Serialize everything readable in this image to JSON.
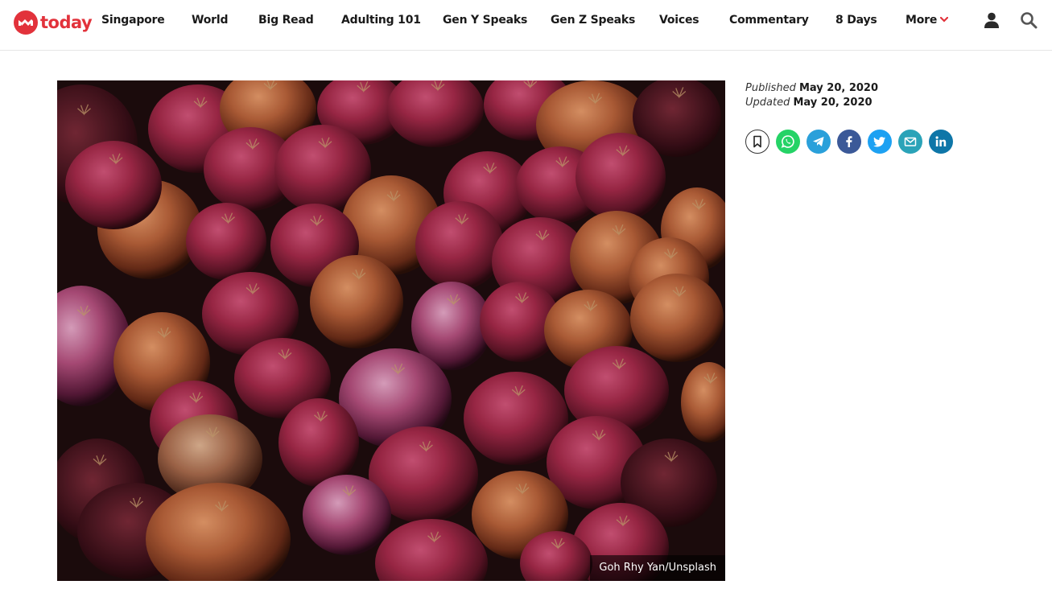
{
  "brand": {
    "name": "today",
    "color": "#e2323b"
  },
  "nav": {
    "items": [
      {
        "label": "Singapore"
      },
      {
        "label": "World"
      },
      {
        "label": "Big Read"
      },
      {
        "label": "Adulting 101"
      },
      {
        "label": "Gen Y Speaks"
      },
      {
        "label": "Gen Z Speaks"
      },
      {
        "label": "Voices"
      },
      {
        "label": "Commentary"
      },
      {
        "label": "8 Days"
      },
      {
        "label": "More"
      }
    ]
  },
  "header_icons": [
    "user-icon",
    "search-icon"
  ],
  "article": {
    "hero_credit": "Goh Rhy Yan/Unsplash",
    "published_label": "Published",
    "published_date": "May 20, 2020",
    "updated_label": "Updated",
    "updated_date": "May 20, 2020"
  },
  "share": [
    {
      "icon": "bookmark-icon",
      "color": "#ffffff"
    },
    {
      "icon": "whatsapp-icon",
      "color": "#25d366"
    },
    {
      "icon": "telegram-icon",
      "color": "#2aa0da"
    },
    {
      "icon": "facebook-icon",
      "color": "#3b5998"
    },
    {
      "icon": "twitter-icon",
      "color": "#1da1f2"
    },
    {
      "icon": "email-icon",
      "color": "#2aa3b8"
    },
    {
      "icon": "linkedin-icon",
      "color": "#0e76a8"
    }
  ]
}
